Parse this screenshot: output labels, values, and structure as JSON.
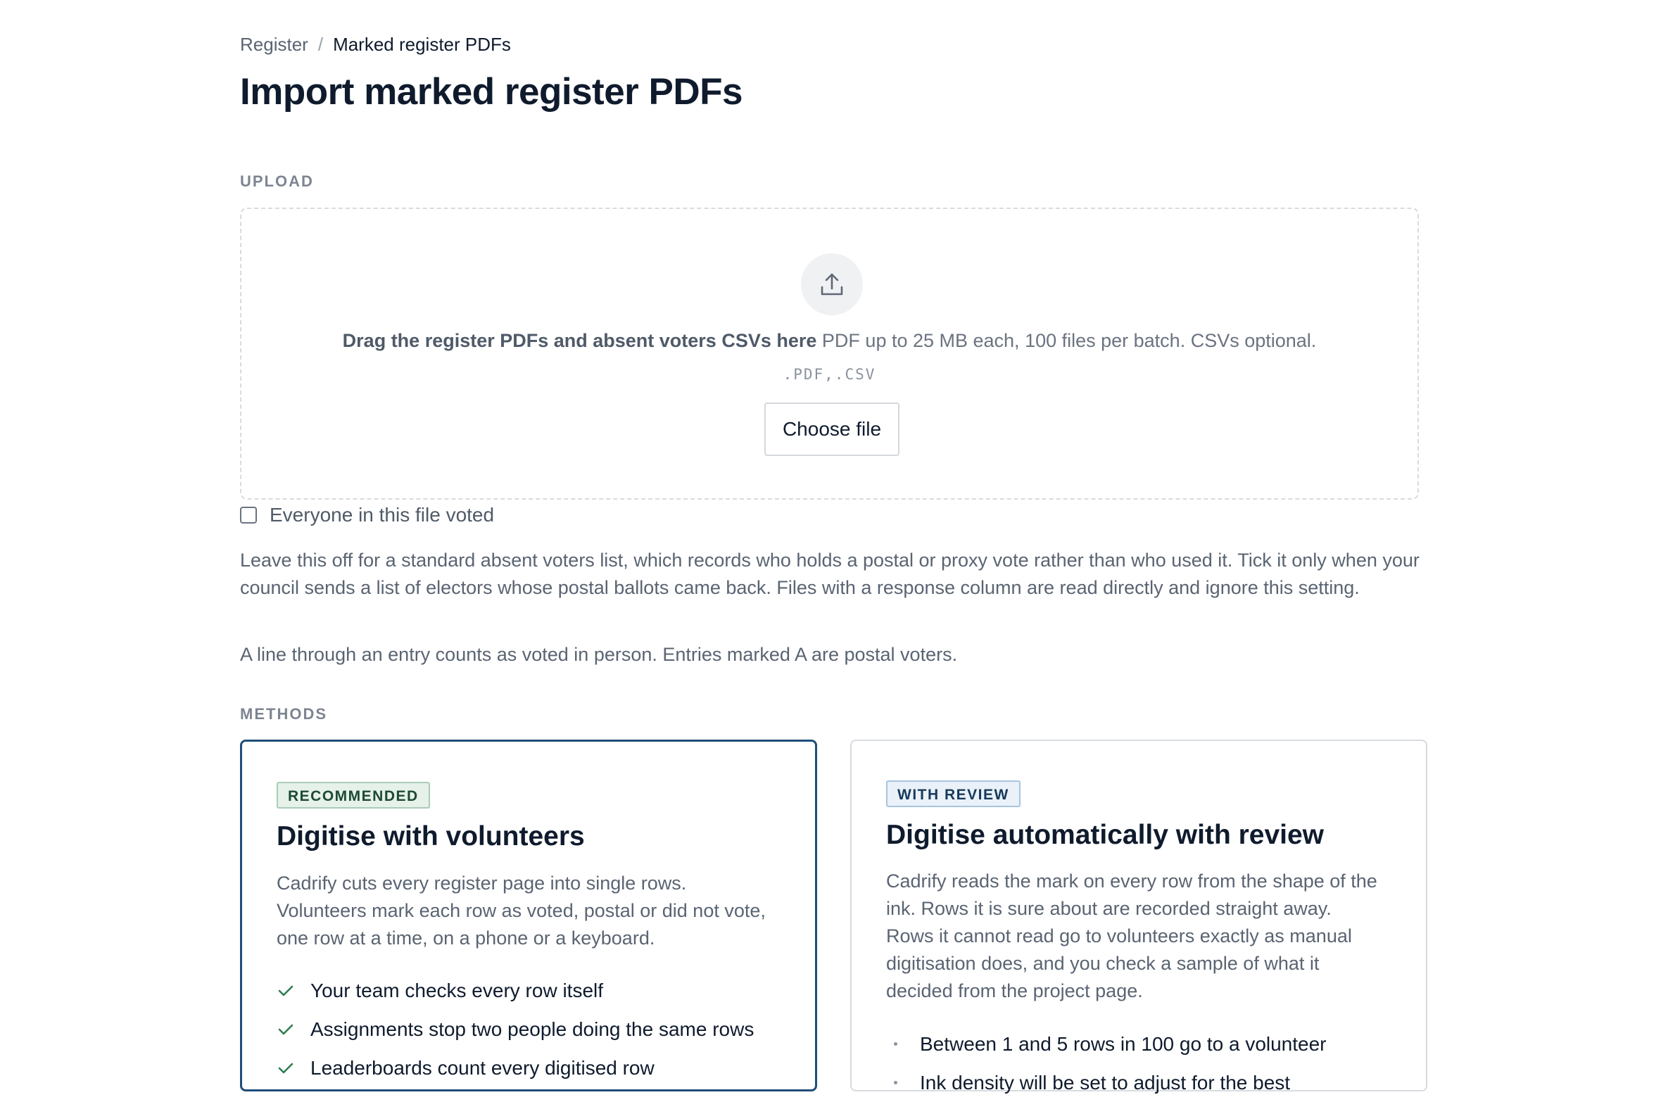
{
  "breadcrumb": {
    "parent": "Register",
    "separator": "/",
    "current": "Marked register PDFs"
  },
  "page_title": "Import marked register PDFs",
  "upload": {
    "section_label": "UPLOAD",
    "icon": "upload-icon",
    "drop_text": "Drag the register PDFs and absent voters CSVs here",
    "drop_hint": "PDF up to 25 MB each, 100 files per batch. CSVs optional.",
    "accepted_types": ".PDF,.CSV",
    "choose_label": "Choose file"
  },
  "everyone_voted": {
    "label": "Everyone in this file voted",
    "checked": false
  },
  "help_text": "Leave this off for a standard absent voters list, which records who holds a postal or proxy vote rather than who used it. Tick it only when your council sends a list of electors whose postal ballots came back. Files with a response column are read directly and ignore this setting.",
  "legend_text": "A line through an entry counts as voted in person. Entries marked A are postal voters.",
  "methods": {
    "section_label": "METHODS",
    "cards": [
      {
        "badge": "RECOMMENDED",
        "title": "Digitise with volunteers",
        "description": "Cadrify cuts every register page into single rows. Volunteers mark each row as voted, postal or did not vote, one row at a time, on a phone or a keyboard.",
        "features": [
          "Your team checks every row itself",
          "Assignments stop two people doing the same rows",
          "Leaderboards count every digitised row"
        ],
        "feature_icon": "check-icon",
        "selected": true
      },
      {
        "badge": "WITH REVIEW",
        "title": "Digitise automatically with review",
        "description": "Cadrify reads the mark on every row from the shape of the ink. Rows it is sure about are recorded straight away. Rows it cannot read go to volunteers exactly as manual digitisation does, and you check a sample of what it decided from the project page.",
        "features": [
          "Between 1 and 5 rows in 100 go to a volunteer",
          "Ink density will be set to adjust for the best"
        ],
        "feature_icon": "bullet-icon",
        "selected": false
      }
    ]
  },
  "colors": {
    "primary_border": "#1f4e79",
    "recommended_badge_bg": "#e6f1ea",
    "review_badge_bg": "#eaf1f8",
    "check": "#2e7d52"
  }
}
